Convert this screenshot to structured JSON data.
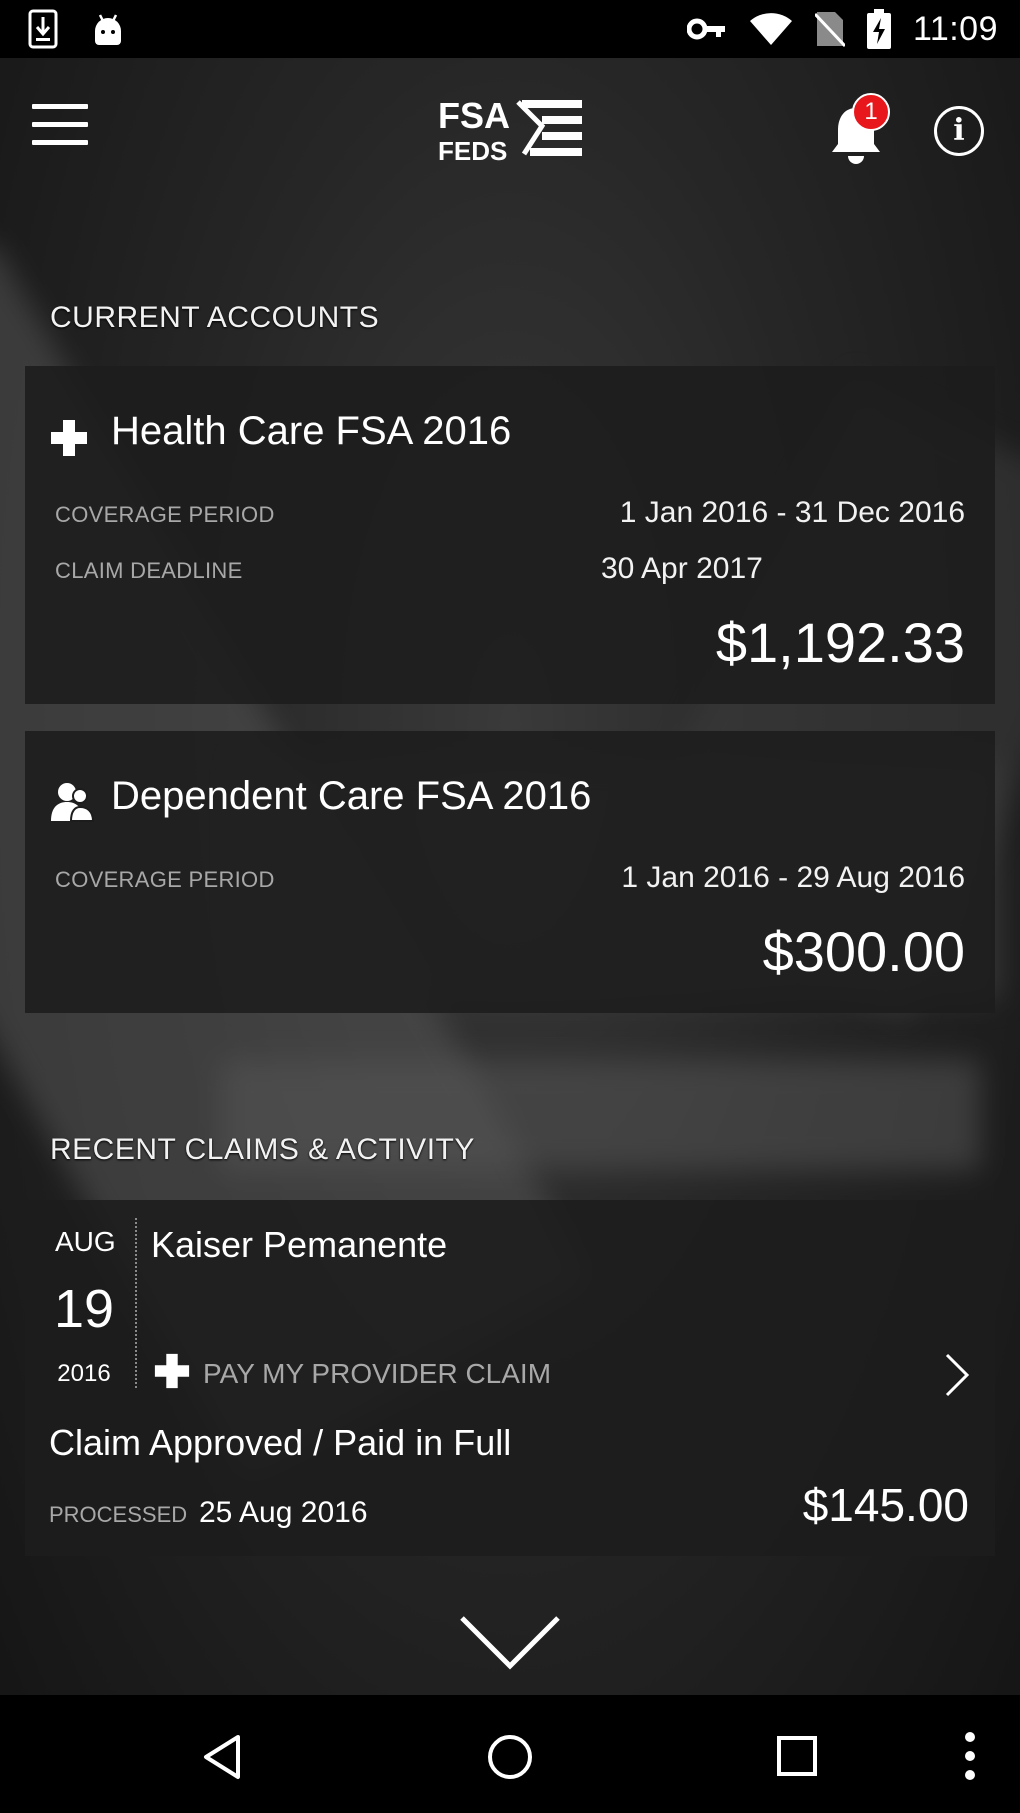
{
  "status_bar": {
    "time": "11:09",
    "icons": [
      "download-icon",
      "android-icon",
      "vpn-key-icon",
      "wifi-icon",
      "no-sim-icon",
      "battery-charging-icon"
    ]
  },
  "app_bar": {
    "logo_text_top": "FSA",
    "logo_text_bottom": "FEDS",
    "notification_count": "1",
    "info_glyph": "i"
  },
  "current_accounts": {
    "section_title": "CURRENT ACCOUNTS",
    "accounts": [
      {
        "icon": "medical-cross-icon",
        "title": "Health Care FSA 2016",
        "coverage_label": "COVERAGE PERIOD",
        "coverage_value": "1 Jan 2016 - 31 Dec 2016",
        "deadline_label": "CLAIM DEADLINE",
        "deadline_value": "30 Apr 2017",
        "balance": "$1,192.33"
      },
      {
        "icon": "people-icon",
        "title": "Dependent Care FSA 2016",
        "coverage_label": "COVERAGE PERIOD",
        "coverage_value": "1 Jan 2016 - 29 Aug 2016",
        "balance": "$300.00"
      }
    ]
  },
  "recent_claims": {
    "section_title": "RECENT CLAIMS & ACTIVITY",
    "claims": [
      {
        "month": "AUG",
        "day": "19",
        "year": "2016",
        "provider": "Kaiser Pemanente",
        "claim_type": "PAY MY PROVIDER CLAIM",
        "status": "Claim Approved / Paid in Full",
        "processed_label": "PROCESSED",
        "processed_date": "25 Aug 2016",
        "amount": "$145.00"
      }
    ]
  },
  "nav_bar": {
    "buttons": [
      "back-icon",
      "home-icon",
      "recents-icon",
      "overflow-menu-icon"
    ]
  }
}
